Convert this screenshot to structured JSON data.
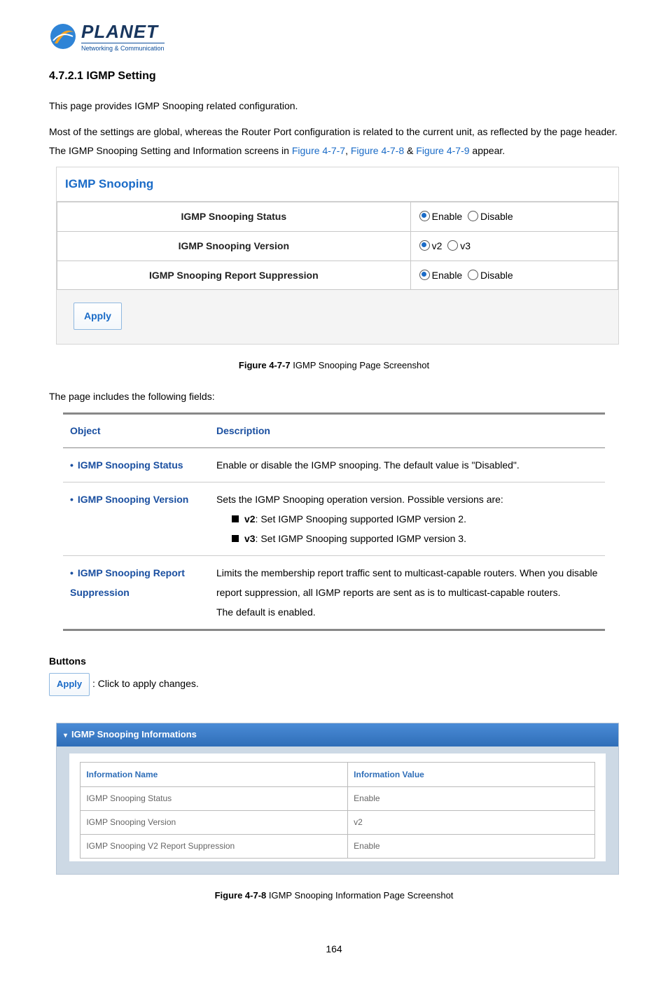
{
  "logo": {
    "brand": "PLANET",
    "sub": "Networking & Communication"
  },
  "heading": "4.7.2.1 IGMP Setting",
  "intro1": "This page provides IGMP Snooping related configuration.",
  "intro2_a": "Most of the settings are global, whereas the Router Port configuration is related to the current unit, as reflected by the page header. The IGMP Snooping Setting and Information screens in ",
  "intro2_links": {
    "l1": "Figure 4-7-7",
    "l2": "Figure 4-7-8",
    "l3": "Figure 4-7-9"
  },
  "intro2_sep1": ", ",
  "intro2_sep2": " & ",
  "intro2_b": " appear.",
  "scr1": {
    "title": "IGMP Snooping",
    "rows": [
      {
        "label": "IGMP Snooping Status",
        "opt1": "Enable",
        "opt2": "Disable"
      },
      {
        "label": "IGMP Snooping Version",
        "opt1": "v2",
        "opt2": "v3"
      },
      {
        "label": "IGMP Snooping Report Suppression",
        "opt1": "Enable",
        "opt2": "Disable"
      }
    ],
    "apply": "Apply"
  },
  "caption1_bold": "Figure 4-7-7",
  "caption1_rest": " IGMP Snooping Page Screenshot",
  "fields_intro": "The page includes the following fields:",
  "desc_table": {
    "h1": "Object",
    "h2": "Description",
    "rows": [
      {
        "obj": "IGMP Snooping Status",
        "lines": [
          "Enable or disable the IGMP snooping. The default value is \"Disabled\"."
        ]
      },
      {
        "obj": "IGMP Snooping Version",
        "lines": [
          "Sets the IGMP Snooping operation version. Possible versions are:",
          {
            "sq": true,
            "bold": "v2",
            "text": ": Set IGMP Snooping supported IGMP version 2."
          },
          {
            "sq": true,
            "bold": "v3",
            "text": ": Set IGMP Snooping supported IGMP version 3."
          }
        ]
      },
      {
        "obj": "IGMP Snooping Report Suppression",
        "lines": [
          "Limits the membership report traffic sent to multicast-capable routers. When you disable report suppression, all IGMP reports are sent as is to multicast-capable routers.",
          "The default is enabled."
        ]
      }
    ]
  },
  "buttons_h": "Buttons",
  "buttons_apply": "Apply",
  "buttons_desc": ": Click to apply changes.",
  "scr2": {
    "bar": "IGMP Snooping Informations",
    "h1": "Information Name",
    "h2": "Information Value",
    "rows": [
      {
        "name": "IGMP Snooping Status",
        "value": "Enable"
      },
      {
        "name": "IGMP Snooping Version",
        "value": "v2"
      },
      {
        "name": "IGMP Snooping V2 Report Suppression",
        "value": "Enable"
      }
    ]
  },
  "caption2_bold": "Figure 4-7-8",
  "caption2_rest": " IGMP Snooping Information Page Screenshot",
  "page_num": "164"
}
